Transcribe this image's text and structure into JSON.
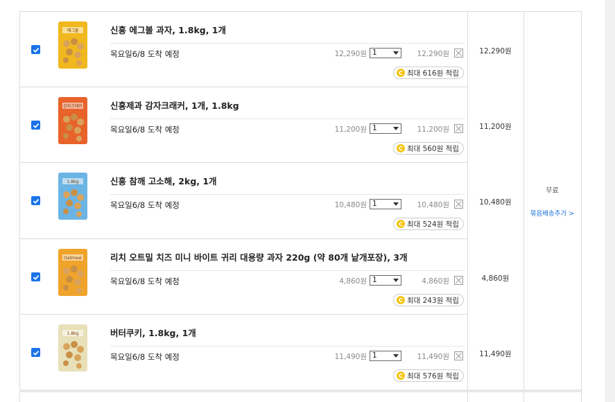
{
  "items": [
    {
      "title": "신흥 에그볼 과자, 1.8kg, 1개",
      "delivery": "목요일6/8 도착 예정",
      "unit_price": "12,290원",
      "quantity": "1",
      "line_total": "12,290원",
      "reward": "최대 616원 적립",
      "row_price": "12,290원",
      "checked": true,
      "thumb_color": "#f0b81e",
      "thumb_label": "에그볼"
    },
    {
      "title": "신흥제과 감자크래커, 1개, 1.8kg",
      "delivery": "목요일6/8 도착 예정",
      "unit_price": "11,200원",
      "quantity": "1",
      "line_total": "11,200원",
      "reward": "최대 560원 적립",
      "row_price": "11,200원",
      "checked": true,
      "thumb_color": "#e8632a",
      "thumb_label": "감자크래커"
    },
    {
      "title": "신흥 참깨 고소해, 2kg, 1개",
      "delivery": "목요일6/8 도착 예정",
      "unit_price": "10,480원",
      "quantity": "1",
      "line_total": "10,480원",
      "reward": "최대 524원 적립",
      "row_price": "10,480원",
      "checked": true,
      "thumb_color": "#6cb4e4",
      "thumb_label": "1.8kg"
    },
    {
      "title": "리치 오트밀 치즈 미니 바이트 귀리 대용량 과자 220g (약 80개 낱개포장), 3개",
      "delivery": "목요일6/8 도착 예정",
      "unit_price": "4,860원",
      "quantity": "1",
      "line_total": "4,860원",
      "reward": "최대 243원 적립",
      "row_price": "4,860원",
      "checked": true,
      "thumb_color": "#f0a32a",
      "thumb_label": "Oatmeal"
    },
    {
      "title": "버터쿠키, 1.8kg, 1개",
      "delivery": "목요일6/8 도착 예정",
      "unit_price": "11,490원",
      "quantity": "1",
      "line_total": "11,490원",
      "reward": "최대 576원 적립",
      "row_price": "11,490원",
      "checked": true,
      "thumb_color": "#e8e0b8",
      "thumb_label": "1.8kg"
    }
  ],
  "shipping": {
    "fee": "무료",
    "link": "묶음배송추가 >"
  }
}
